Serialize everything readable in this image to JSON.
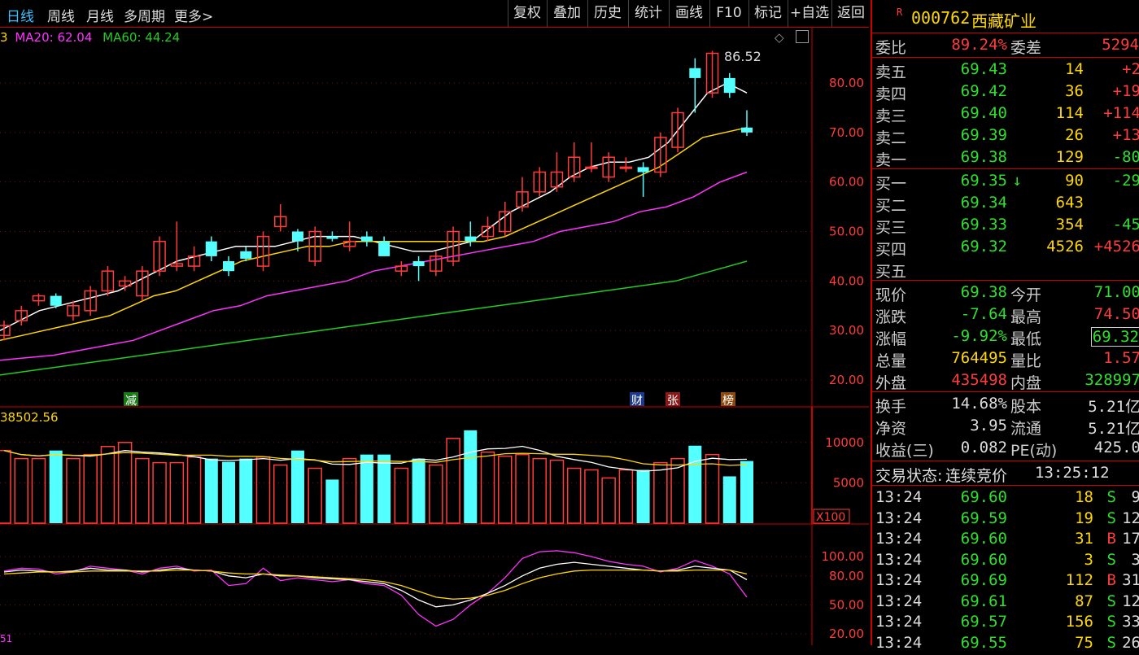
{
  "tabs": [
    "日线",
    "周线",
    "月线",
    "多周期",
    "更多>"
  ],
  "toolbar_buttons": [
    "复权",
    "叠加",
    "历史",
    "统计",
    "画线",
    "F10",
    "标记",
    "+自选",
    "返回"
  ],
  "stock": {
    "badge": "R",
    "code": "000762",
    "name": "西藏矿业"
  },
  "ma_legend": {
    "prefix": "3",
    "ma20": "MA20: 62.04",
    "ma60": "MA60: 44.24"
  },
  "high_marker": "86.52",
  "price_axis": [
    "80.00",
    "70.00",
    "60.00",
    "50.00",
    "40.00",
    "30.00",
    "20.00"
  ],
  "event_tags": [
    {
      "text": "减",
      "color": "#1a7a1a"
    },
    {
      "text": "财",
      "color": "#1d3a8a"
    },
    {
      "text": "张",
      "color": "#8a1a1a"
    },
    {
      "text": "榜",
      "color": "#8a4a10"
    }
  ],
  "volume_label": "38502.56",
  "volume_axis": [
    "10000",
    "5000",
    "X100"
  ],
  "osc_axis": [
    "100.00",
    "80.00",
    "50.00",
    "20.00"
  ],
  "osc_bottom_label": "51",
  "order_ratio": {
    "label1": "委比",
    "value1": "89.24%",
    "label2": "委差",
    "value2": "5294"
  },
  "asks": [
    {
      "label": "卖五",
      "price": "69.43",
      "vol": "14",
      "chg": "+2"
    },
    {
      "label": "卖四",
      "price": "69.42",
      "vol": "36",
      "chg": "+19"
    },
    {
      "label": "卖三",
      "price": "69.40",
      "vol": "114",
      "chg": "+114"
    },
    {
      "label": "卖二",
      "price": "69.39",
      "vol": "26",
      "chg": "+13"
    },
    {
      "label": "卖一",
      "price": "69.38",
      "vol": "129",
      "chg": "-80"
    }
  ],
  "bids": [
    {
      "label": "买一",
      "price": "69.35",
      "arrow": "↓",
      "vol": "90",
      "chg": "-29"
    },
    {
      "label": "买二",
      "price": "69.34",
      "arrow": "",
      "vol": "643",
      "chg": ""
    },
    {
      "label": "买三",
      "price": "69.33",
      "arrow": "",
      "vol": "354",
      "chg": "-45"
    },
    {
      "label": "买四",
      "price": "69.32",
      "arrow": "",
      "vol": "4526",
      "chg": "+4526"
    },
    {
      "label": "买五",
      "price": "",
      "arrow": "",
      "vol": "",
      "chg": ""
    }
  ],
  "quote": [
    {
      "l1": "现价",
      "v1": "69.38",
      "l2": "今开",
      "v2": "71.00"
    },
    {
      "l1": "涨跌",
      "v1": "-7.64",
      "l2": "最高",
      "v2": "74.50"
    },
    {
      "l1": "涨幅",
      "v1": "-9.92%",
      "l2": "最低",
      "v2": "69.32"
    },
    {
      "l1": "总量",
      "v1": "764495",
      "l2": "量比",
      "v2": "1.57"
    },
    {
      "l1": "外盘",
      "v1": "435498",
      "l2": "内盘",
      "v2": "328997"
    }
  ],
  "fundamentals": [
    {
      "l1": "换手",
      "v1": "14.68%",
      "l2": "股本",
      "v2": "5.21亿"
    },
    {
      "l1": "净资",
      "v1": "3.95",
      "l2": "流通",
      "v2": "5.21亿"
    },
    {
      "l1": "收益(三)",
      "v1": "0.082",
      "l2": "PE(动)",
      "v2": "425.0"
    }
  ],
  "trade_status": {
    "label": "交易状态:",
    "state": "连续竞价",
    "time": "13:25:12"
  },
  "ticks": [
    {
      "time": "13:24",
      "price": "69.60",
      "vol": "18",
      "side": "S",
      "n": "9"
    },
    {
      "time": "13:24",
      "price": "69.59",
      "vol": "19",
      "side": "S",
      "n": "12"
    },
    {
      "time": "13:24",
      "price": "69.60",
      "vol": "31",
      "side": "B",
      "n": "17"
    },
    {
      "time": "13:24",
      "price": "69.60",
      "vol": "3",
      "side": "S",
      "n": "3"
    },
    {
      "time": "13:24",
      "price": "69.69",
      "vol": "112",
      "side": "B",
      "n": "31"
    },
    {
      "time": "13:24",
      "price": "69.61",
      "vol": "87",
      "side": "S",
      "n": "12"
    },
    {
      "time": "13:24",
      "price": "69.57",
      "vol": "156",
      "side": "S",
      "n": "33"
    },
    {
      "time": "13:24",
      "price": "69.55",
      "vol": "75",
      "side": "S",
      "n": "26"
    }
  ],
  "chart_data": {
    "type": "candlestick",
    "price_range": [
      20,
      86
    ],
    "candles": [
      [
        29,
        31,
        28,
        32
      ],
      [
        32,
        34,
        31,
        35
      ],
      [
        36,
        37,
        35,
        37.5
      ],
      [
        37,
        35,
        34.5,
        37.5
      ],
      [
        33,
        35,
        32,
        36
      ],
      [
        34,
        38,
        33,
        39
      ],
      [
        38,
        42,
        37,
        43
      ],
      [
        39,
        40,
        38,
        41
      ],
      [
        37,
        42,
        36,
        43
      ],
      [
        42,
        48,
        41,
        49
      ],
      [
        43,
        43.5,
        42,
        52
      ],
      [
        43,
        45,
        42,
        47
      ],
      [
        48,
        45,
        44,
        49
      ],
      [
        44,
        42,
        41,
        45
      ],
      [
        46,
        44.5,
        44,
        47
      ],
      [
        43,
        49,
        42,
        50
      ],
      [
        51,
        53,
        50,
        55.5
      ],
      [
        50,
        48,
        46,
        50.5
      ],
      [
        44,
        50,
        43,
        51
      ],
      [
        49,
        48.5,
        48,
        50
      ],
      [
        47,
        48,
        46,
        52
      ],
      [
        49,
        48,
        47,
        50
      ],
      [
        48,
        45,
        45,
        49
      ],
      [
        42,
        43,
        41,
        44
      ],
      [
        44,
        43,
        40,
        45
      ],
      [
        42,
        45,
        41,
        46
      ],
      [
        44,
        50,
        43,
        51
      ],
      [
        49,
        48,
        47,
        52
      ],
      [
        49,
        51,
        48,
        53
      ],
      [
        50,
        54,
        49,
        56
      ],
      [
        55,
        58,
        54,
        61
      ],
      [
        58,
        62,
        57,
        63
      ],
      [
        59,
        62,
        58,
        66
      ],
      [
        61,
        65,
        60,
        68
      ],
      [
        63,
        63,
        62,
        68
      ],
      [
        61,
        65,
        60,
        66
      ],
      [
        63,
        63,
        62,
        65
      ],
      [
        63,
        62,
        57,
        64
      ],
      [
        62,
        69,
        61,
        70
      ],
      [
        67,
        74,
        66,
        75
      ],
      [
        83,
        81,
        74,
        85
      ],
      [
        78,
        86,
        77,
        86.5
      ],
      [
        81,
        78,
        77,
        82
      ],
      [
        71,
        70,
        69.3,
        74.5
      ]
    ],
    "volume_range": [
      0,
      13000
    ],
    "volumes": [
      9000,
      8000,
      8000,
      9000,
      8000,
      8500,
      9500,
      10000,
      8000,
      7500,
      7500,
      8200,
      8000,
      7600,
      8000,
      8200,
      7200,
      9000,
      6800,
      5400,
      8000,
      8500,
      8500,
      6800,
      8000,
      7200,
      10500,
      11500,
      8800,
      8300,
      8500,
      8000,
      7800,
      6800,
      6600,
      5600,
      6600,
      6600,
      7500,
      8000,
      9600,
      8500,
      5800,
      7700
    ],
    "ma_series": [
      {
        "color": "#ffffff",
        "values": [
          30,
          32,
          34,
          35,
          36,
          37,
          38,
          40,
          42,
          44,
          45,
          46,
          47,
          47,
          47,
          48,
          49,
          49,
          49,
          48,
          47,
          46,
          46,
          47,
          48,
          51,
          54,
          56,
          58,
          61,
          63,
          64,
          64,
          65,
          68,
          73,
          78,
          80,
          78
        ]
      },
      {
        "color": "#ffd700",
        "values": [
          28,
          29,
          30,
          31,
          32,
          33,
          35,
          37,
          38,
          40,
          42,
          44,
          45,
          46,
          47,
          47,
          48,
          48,
          48,
          48,
          48,
          48,
          48,
          49,
          51,
          53,
          55,
          57,
          59,
          61,
          63,
          66,
          69,
          70,
          71
        ]
      },
      {
        "color": "#ff33ff",
        "values": [
          24,
          24.5,
          25,
          26,
          27,
          28,
          30,
          32,
          34,
          35,
          37,
          38,
          39,
          40,
          42,
          43,
          44,
          45,
          46,
          47,
          48,
          50,
          51,
          52,
          54,
          55,
          57,
          60,
          62
        ]
      },
      {
        "color": "#22cc22",
        "values": [
          21,
          22,
          23,
          24,
          25,
          26,
          27,
          28,
          29,
          30,
          31,
          32,
          33,
          34,
          35,
          36,
          37,
          38,
          39,
          40,
          42,
          44
        ]
      }
    ]
  }
}
